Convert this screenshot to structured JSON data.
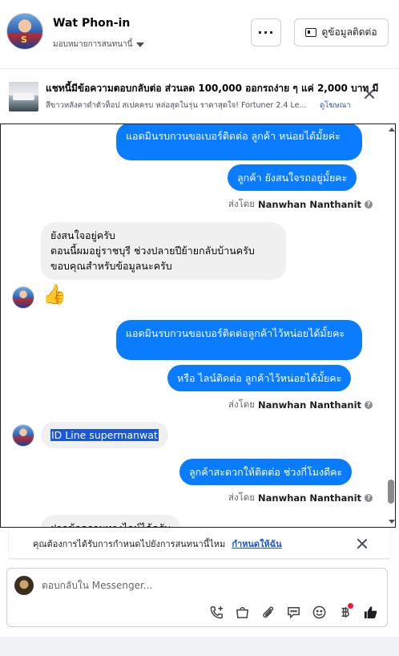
{
  "header": {
    "name": "Wat Phon-in",
    "assignment": "มอบหมายการสนทนานี้",
    "more_label": "···",
    "contact_label": "ดูข้อมูลติดต่อ"
  },
  "ad": {
    "title": "แชทนี้มีข้อความตอบกลับต่อ ส่วนลด 100,000 ออกรถง่าย ๆ แค่ 2,000 บาท มี...",
    "description": "สีขาวหลังคาดำตัวท็อป สเปคครบ หล่อสุดในรุ่น ราคาสุดใจ! Fortuner 2.4 Le...",
    "link": "ดูโฆษณา"
  },
  "messages": [
    {
      "side": "out",
      "text": "แอดมินรบกวนขอเบอร์ติดต่อ ลูกค้า หน่อยได้มั้ยค่ะ"
    },
    {
      "side": "out",
      "text": "ลูกค้า ยังสนใจรถอยู่มั้ยคะ"
    },
    {
      "side": "in",
      "lines": [
        "ยังสนใจอยู่ครับ",
        "ตอนนี้ผมอยู่ราชบุรี  ช่วงปลายปีย้ายกลับบ้านครับ",
        "ขอบคุณสำหรับข้อมูลนะครับ"
      ]
    },
    {
      "side": "in",
      "text": "👍"
    },
    {
      "side": "out",
      "text": "แอดมินรบกวนขอเบอร์ติดต่อลูกค้าไว้หน่อยได้มั้ยคะ"
    },
    {
      "side": "out",
      "text": "หรือ ไลน์ติดต่อ ลูกค้าไว้หน่อยได้มั้ยคะ"
    },
    {
      "side": "in",
      "text": "ID Line supermanwat"
    },
    {
      "side": "out",
      "text": "ลูกค้าสะดวกให้ติดต่อ ช่วงกี่โมงดีคะ"
    },
    {
      "side": "in",
      "text": "ฝากข้อความทางไลน์ได้ครับ"
    }
  ],
  "sent_by": {
    "prefix": "ส่งโดย",
    "name": "Nanwhan Nanthanit"
  },
  "appointment": {
    "text": "คุณต้องการได้รับการกำหนดไปยังการสนทนานี้ไหม",
    "link": "กำหนดให้ฉัน"
  },
  "composer": {
    "placeholder": "ตอบกลับใน Messenger..."
  },
  "colors": {
    "outgoing_bubble": "#0a7cff",
    "incoming_bubble": "#f0f0f0",
    "link": "#1a56db"
  }
}
